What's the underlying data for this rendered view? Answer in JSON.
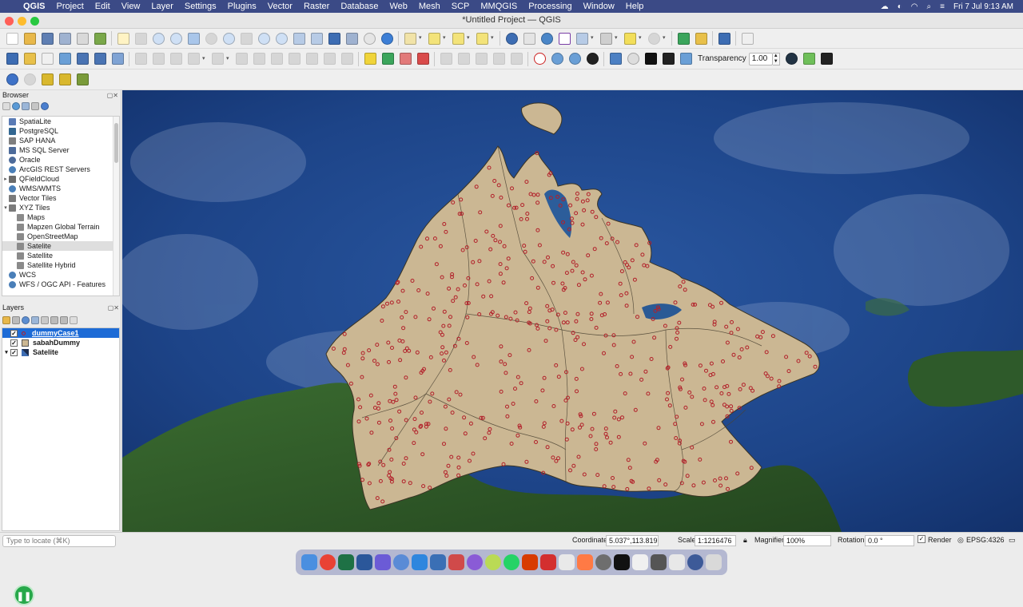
{
  "menubar": {
    "app": "QGIS",
    "items": [
      "Project",
      "Edit",
      "View",
      "Layer",
      "Settings",
      "Plugins",
      "Vector",
      "Raster",
      "Database",
      "Web",
      "Mesh",
      "SCP",
      "MMQGIS",
      "Processing",
      "Window",
      "Help"
    ],
    "datetime": "Fri 7 Jul  9:13 AM"
  },
  "window": {
    "title": "*Untitled Project — QGIS"
  },
  "toolbar": {
    "transparency_label": "Transparency",
    "transparency_value": "1.00"
  },
  "browser": {
    "title": "Browser",
    "items": [
      {
        "label": "SpatiaLite",
        "icon": "spatialite-icon",
        "color": "#5a7bb5"
      },
      {
        "label": "PostgreSQL",
        "icon": "postgresql-elephant-icon",
        "color": "#336791"
      },
      {
        "label": "SAP HANA",
        "icon": "sap-hana-icon",
        "color": "#7f7f7f"
      },
      {
        "label": "MS SQL Server",
        "icon": "mssql-icon",
        "color": "#4d6b9a"
      },
      {
        "label": "Oracle",
        "icon": "oracle-icon",
        "color": "#4d6b9a"
      },
      {
        "label": "ArcGIS REST Servers",
        "icon": "arcgis-globe-icon",
        "color": "#4a7fb8"
      },
      {
        "label": "QFieldCloud",
        "icon": "qfieldcloud-icon",
        "color": "#6b6b6b"
      },
      {
        "label": "WMS/WMTS",
        "icon": "wms-globe-icon",
        "color": "#4a7fb8"
      },
      {
        "label": "Vector Tiles",
        "icon": "vector-tiles-grid-icon",
        "color": "#7b7b7b"
      },
      {
        "label": "XYZ Tiles",
        "icon": "xyz-tiles-grid-icon",
        "color": "#7b7b7b"
      },
      {
        "label": "Maps",
        "icon": "tile-grid-icon",
        "color": "#8a8a8a"
      },
      {
        "label": "Mapzen Global Terrain",
        "icon": "tile-grid-icon",
        "color": "#8a8a8a"
      },
      {
        "label": "OpenStreetMap",
        "icon": "tile-grid-icon",
        "color": "#8a8a8a"
      },
      {
        "label": "Satelite",
        "icon": "tile-grid-icon",
        "color": "#8a8a8a"
      },
      {
        "label": "Satellite",
        "icon": "tile-grid-icon",
        "color": "#8a8a8a"
      },
      {
        "label": "Satellite Hybrid",
        "icon": "tile-grid-icon",
        "color": "#8a8a8a"
      },
      {
        "label": "WCS",
        "icon": "wcs-globe-icon",
        "color": "#4a7fb8"
      },
      {
        "label": "WFS / OGC API - Features",
        "icon": "wfs-globe-icon",
        "color": "#4a7fb8"
      }
    ]
  },
  "layers": {
    "title": "Layers",
    "items": [
      {
        "label": "dummyCase1",
        "checked": "✓",
        "symbol": "point-symbol-icon"
      },
      {
        "label": "sabahDummy",
        "checked": "✓",
        "symbol": "polygon-symbol-icon"
      },
      {
        "label": "Satelite",
        "checked": "✓",
        "symbol": "raster-tile-icon"
      }
    ]
  },
  "statusbar": {
    "locate_placeholder": "Type to locate (⌘K)",
    "coordinate_label": "Coordinate",
    "coordinate_value": "5.037°,113.819°",
    "scale_label": "Scale",
    "scale_value": "1:1216476",
    "magnifier_label": "Magnifier",
    "magnifier_value": "100%",
    "rotation_label": "Rotation",
    "rotation_value": "0.0 °",
    "render_label": "Render",
    "render_checked": "✓",
    "crs": "EPSG:4326"
  },
  "colors": {
    "menubar": "#3b4a86",
    "selection": "#1d6bd6",
    "sabah_fill": "#cbb793",
    "point_stroke": "#b2202a",
    "ocean": "#173a78",
    "land_green": "#2f5a2a"
  }
}
